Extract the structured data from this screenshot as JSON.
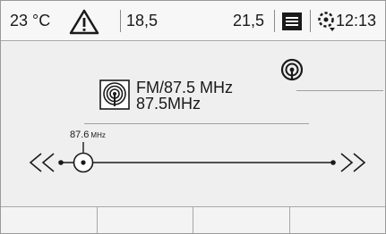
{
  "status_bar": {
    "outside_temp": "23 °C",
    "driver_temp": "18,5",
    "passenger_temp": "21,5",
    "clock": "12:13",
    "icons": [
      "warning-triangle-icon",
      "notes-menu-icon",
      "settings-gear-icon"
    ]
  },
  "radio": {
    "source_icon": "radio-broadcast-icon",
    "band_frequency": "FM/87.5 MHz",
    "station_name": "87.5MHz",
    "corner_icon": "radio-signal-icon"
  },
  "tuner": {
    "current_frequency": "87.6",
    "unit": "MHz",
    "prev_icon": "seek-back-icon",
    "next_icon": "seek-forward-icon"
  },
  "softkeys": [
    "",
    "",
    "",
    ""
  ]
}
